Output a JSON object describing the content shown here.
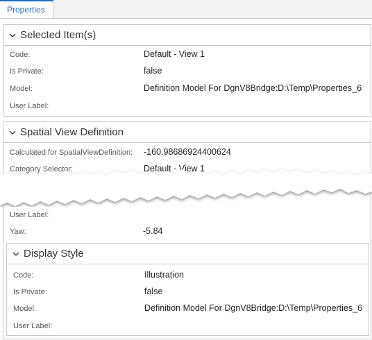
{
  "tabs": [
    {
      "label": "Properties"
    }
  ],
  "selected_items": {
    "title": "Selected Item(s)",
    "rows": [
      {
        "label": "Code:",
        "value": "Default - View 1"
      },
      {
        "label": "Is Private:",
        "value": "false"
      },
      {
        "label": "Model:",
        "value": "Definition Model For DgnV8Bridge:D:\\Temp\\Properties_6"
      },
      {
        "label": "User Label:",
        "value": ""
      }
    ]
  },
  "spatial_view_definition": {
    "title": "Spatial View Definition",
    "rows": [
      {
        "label": "Calculated for SpatialViewDefinition:",
        "value": "-160.98686924400624"
      },
      {
        "label": "Category Selector:",
        "value": "Default - View 1"
      }
    ],
    "lower_rows": [
      {
        "label": "User Label:",
        "value": ""
      },
      {
        "label": "Yaw:",
        "value": "-5.84"
      }
    ]
  },
  "display_style": {
    "title": "Display Style",
    "rows": [
      {
        "label": "Code:",
        "value": "Illustration"
      },
      {
        "label": "Is Private:",
        "value": "false"
      },
      {
        "label": "Model:",
        "value": "Definition Model For DgnV8Bridge:D:\\Temp\\Properties_6"
      },
      {
        "label": "User Label:",
        "value": ""
      }
    ]
  },
  "icons": {
    "collapse": "chevron-down-icon"
  },
  "colors": {
    "accent": "#1b6ec2",
    "border": "#c7c7c7"
  }
}
